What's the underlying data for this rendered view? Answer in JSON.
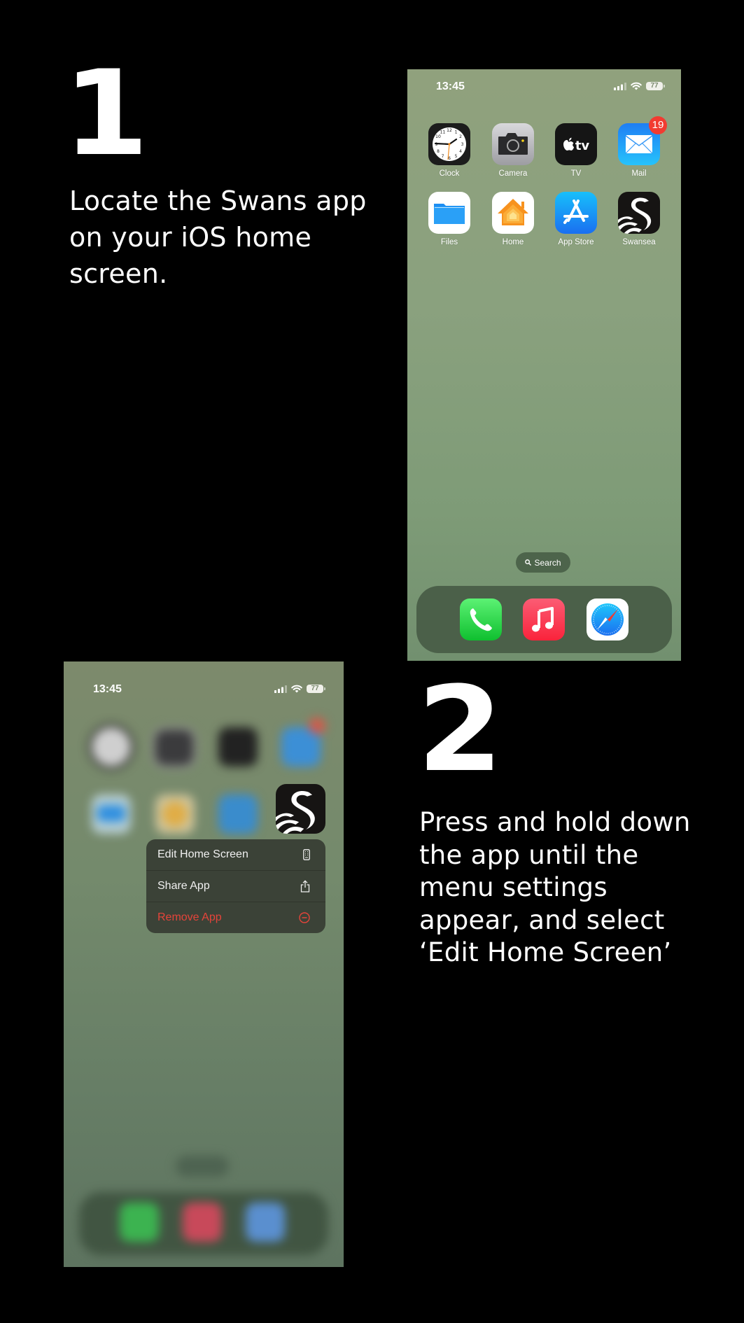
{
  "steps": [
    {
      "number": "1",
      "instruction": "Locate the Swans app\non your iOS home\nscreen."
    },
    {
      "number": "2",
      "instruction": "Press and hold down\nthe app until the\nmenu settings\nappear, and select\n‘Edit Home Screen’"
    }
  ],
  "phone1": {
    "status": {
      "time": "13:45",
      "battery": "77",
      "icons": [
        "cellular-signal-icon",
        "wifi-icon",
        "battery-icon"
      ]
    },
    "apps": [
      {
        "label": "Clock",
        "icon": "clock-icon"
      },
      {
        "label": "Camera",
        "icon": "camera-icon"
      },
      {
        "label": "TV",
        "icon": "apple-tv-icon"
      },
      {
        "label": "Mail",
        "icon": "mail-icon",
        "badge": "19"
      },
      {
        "label": "Files",
        "icon": "files-icon"
      },
      {
        "label": "Home",
        "icon": "home-icon"
      },
      {
        "label": "App Store",
        "icon": "app-store-icon"
      },
      {
        "label": "Swansea",
        "icon": "swansea-icon"
      }
    ],
    "search_label": "Search",
    "dock": [
      {
        "label": "Phone",
        "icon": "phone-icon"
      },
      {
        "label": "Music",
        "icon": "music-icon"
      },
      {
        "label": "Safari",
        "icon": "safari-icon"
      }
    ]
  },
  "phone2": {
    "status": {
      "time": "13:45",
      "battery": "77"
    },
    "context_menu": [
      {
        "label": "Edit Home Screen",
        "icon": "phone-screen-icon",
        "danger": false
      },
      {
        "label": "Share App",
        "icon": "share-icon",
        "danger": false
      },
      {
        "label": "Remove App",
        "icon": "minus-circle-icon",
        "danger": true
      }
    ]
  },
  "colors": {
    "danger": "#e5443a",
    "badge": "#f23b31",
    "wallpaper_green": "#8aa17e"
  }
}
